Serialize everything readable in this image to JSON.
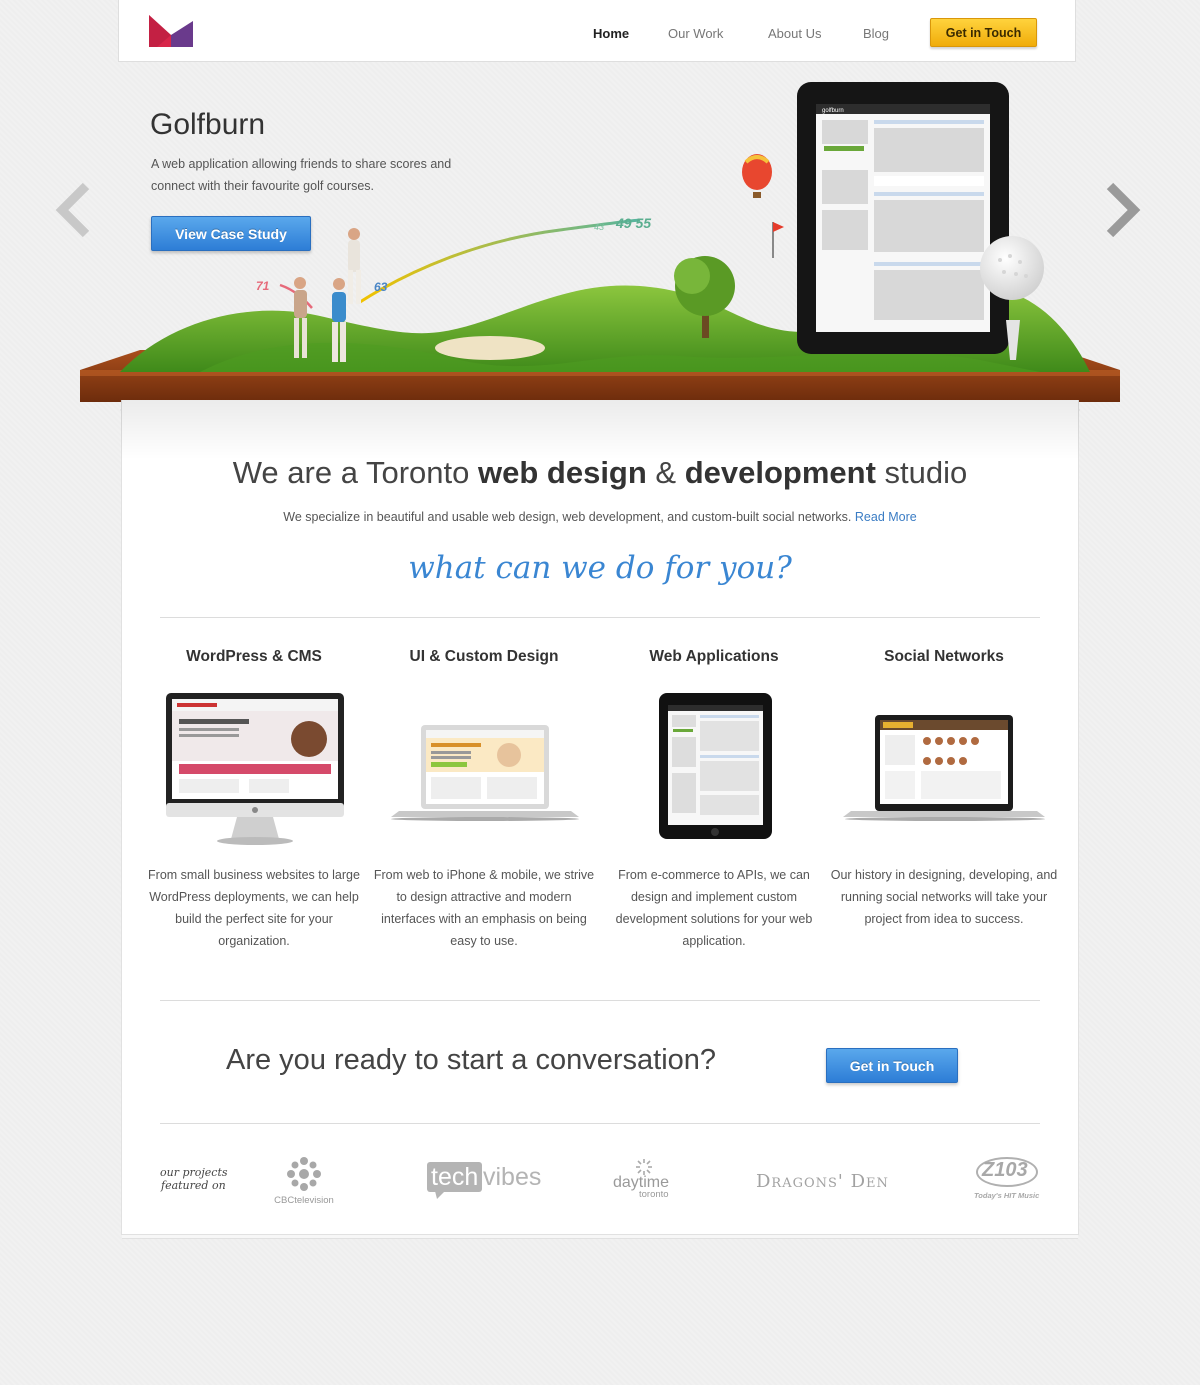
{
  "nav": {
    "home": "Home",
    "our_work": "Our Work",
    "about_us": "About Us",
    "blog": "Blog",
    "cta": "Get in Touch"
  },
  "hero": {
    "title": "Golfburn",
    "description": "A web application allowing friends to share scores and connect with their favourite golf courses.",
    "button": "View Case Study",
    "scores": [
      "71",
      "63",
      "43",
      "49 55"
    ],
    "tablet_app_name": "golfburn"
  },
  "intro": {
    "headline_1": "We are a Toronto ",
    "headline_bold_1": "web design",
    "headline_2": " & ",
    "headline_bold_2": "development",
    "headline_3": " studio",
    "text": "We specialize in beautiful and usable web design, web development, and custom-built social networks.",
    "link": "Read More",
    "script_heading": "what can we do for you?"
  },
  "services": [
    {
      "title": "WordPress & CMS",
      "text": "From small business websites to large WordPress deployments, we can help build the perfect site for your organization.",
      "device": "desktop-monitor"
    },
    {
      "title": "UI & Custom Design",
      "text": "From web to iPhone & mobile, we strive to design attractive and modern interfaces with an emphasis on being easy to use.",
      "device": "laptop"
    },
    {
      "title": "Web Applications",
      "text": "From e-commerce to APIs, we can design and implement custom development solutions for your web application.",
      "device": "tablet"
    },
    {
      "title": "Social Networks",
      "text": "Our history in designing, developing, and running social networks will take your project from idea to success.",
      "device": "laptop"
    }
  ],
  "cta": {
    "text": "Are you ready to start a conversation?",
    "button": "Get in Touch"
  },
  "featured": {
    "label_1": "our projects",
    "label_2": "featured on",
    "logos": {
      "cbc": "CBCtelevision",
      "techvibes_1": "tech",
      "techvibes_2": "vibes",
      "daytime_1": "daytime",
      "daytime_2": "toronto",
      "dragons": "Dragons' Den",
      "z103": "Z103",
      "z103_sub": "Today's HIT Music"
    }
  },
  "colors": {
    "accent_blue": "#2d7dd6",
    "accent_yellow": "#f0ac0a",
    "logo_red": "#d8264a",
    "logo_purple": "#6a3a8c"
  }
}
